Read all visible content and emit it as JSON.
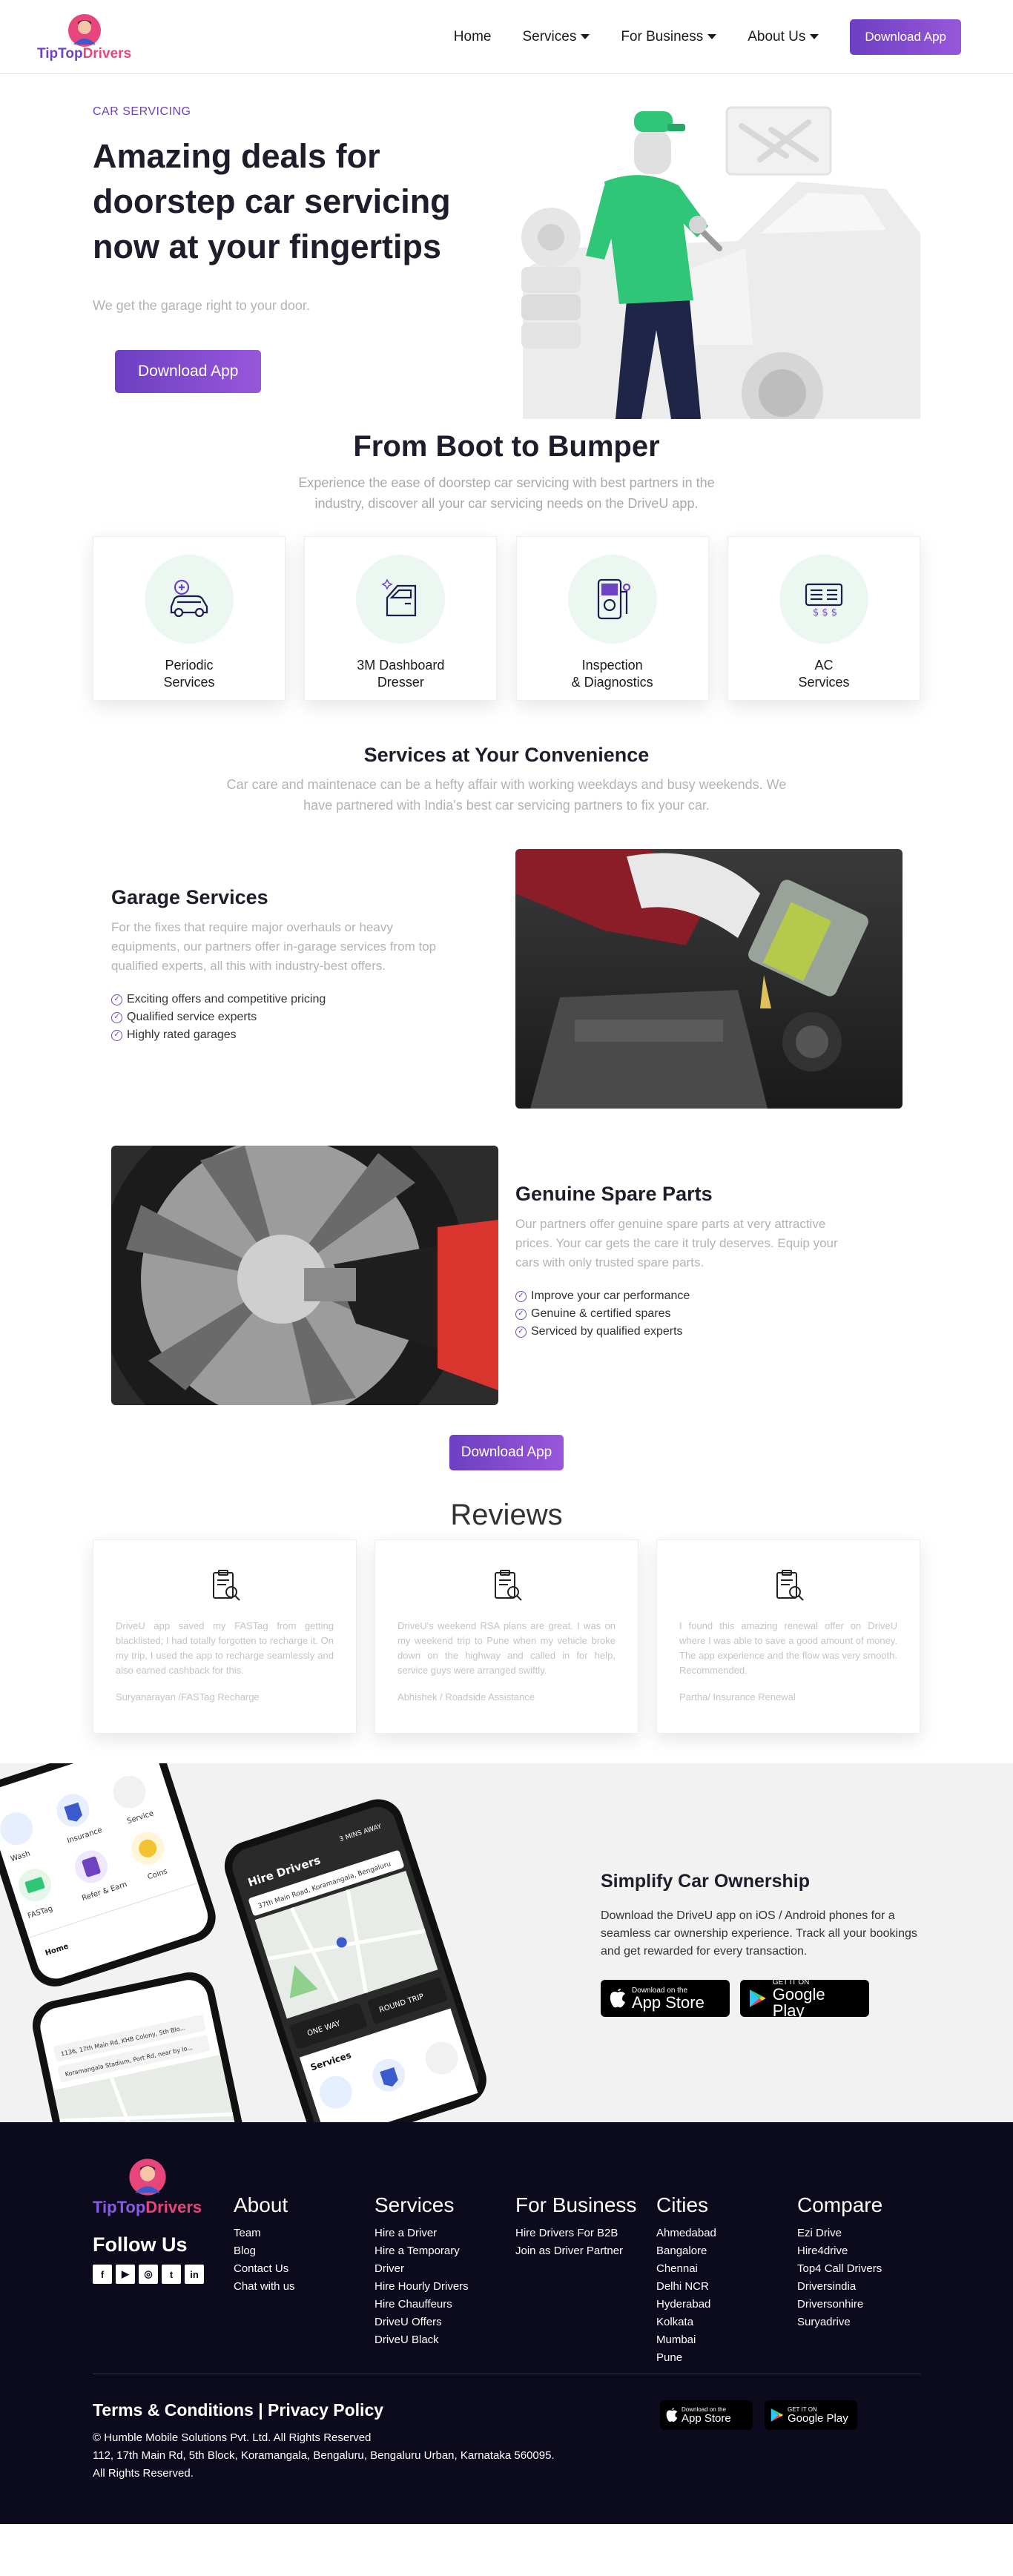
{
  "nav": {
    "brand_a": "TipTop",
    "brand_b": "Drivers",
    "items": [
      {
        "label": "Home"
      },
      {
        "label": "Services"
      },
      {
        "label": "For Business"
      },
      {
        "label": "About Us"
      }
    ],
    "cta": "Download App"
  },
  "hero": {
    "eyebrow": "CAR SERVICING",
    "title": "Amazing deals for doorstep car servicing now at your fingertips",
    "subtitle": "We get the garage right to your door.",
    "cta": "Download App"
  },
  "boot": {
    "title": "From Boot to Bumper",
    "desc": "Experience the ease of doorstep car servicing with best partners in the industry, discover all your car servicing needs on the DriveU app.",
    "services": [
      {
        "label": "Periodic\nServices",
        "icon": "car-wrench-icon"
      },
      {
        "label": "3M Dashboard\nDresser",
        "icon": "car-door-icon"
      },
      {
        "label": "Inspection\n& Diagnostics",
        "icon": "multimeter-icon"
      },
      {
        "label": "AC\nServices",
        "icon": "ac-unit-icon"
      }
    ]
  },
  "convenience": {
    "title": "Services at Your Convenience",
    "desc": "Car care and maintenace can be a hefty affair with working weekdays and busy weekends. We have partnered with India's best car servicing partners to fix your car."
  },
  "garage": {
    "title": "Garage Services",
    "desc": "For the fixes that require major overhauls or heavy equipments, our partners offer in-garage services from top qualified experts, all this with industry-best offers.",
    "points": [
      "Exciting offers and competitive pricing",
      "Qualified service experts",
      "Highly rated garages"
    ]
  },
  "spares": {
    "title": "Genuine Spare Parts",
    "desc": "Our partners offer genuine spare parts at very attractive prices. Your car gets the care it truly deserves. Equip your cars with only trusted spare parts.",
    "points": [
      "Improve your car performance",
      "Genuine & certified spares",
      "Serviced by qualified experts"
    ]
  },
  "mid_cta": "Download App",
  "reviews": {
    "title": "Reviews",
    "items": [
      {
        "text": "DriveU app saved my FASTag from getting blacklisted; I had totally forgotten to recharge it. On my trip, I used the app to recharge seamlessly and also earned cashback for this.",
        "author": "Suryanarayan /FASTag Recharge"
      },
      {
        "text": "DriveU's weekend RSA plans are great. I was on my weekend trip to Pune when my vehicle broke down on the highway and called in for help, service guys were arranged swiftly.",
        "author": "Abhishek / Roadside Assistance"
      },
      {
        "text": "I found this amazing renewal offer on DriveU where I was able to save a good amount of money. The app experience and the flow was very smooth. Recommended.",
        "author": "Partha/ Insurance Renewal"
      }
    ]
  },
  "app": {
    "title": "Simplify Car Ownership",
    "desc": "Download the DriveU app on iOS / Android phones for a seamless car ownership experience. Track all your bookings and get rewarded for every transaction.",
    "appstore_small": "Download on the",
    "appstore_big": "App Store",
    "play_small": "GET IT ON",
    "play_big": "Google Play",
    "phone": {
      "hire_title": "Hire Drivers",
      "eta": "3 MINS AWAY",
      "address": "37th Main Road, Koramangala, Bengaluru",
      "one_way": "ONE WAY",
      "round_trip": "ROUND TRIP",
      "services_label": "Services",
      "grid": [
        "Wash",
        "Insurance",
        "Service",
        "FASTag",
        "Refer & Earn",
        "Coins"
      ],
      "tab_home": "Home",
      "search_a": "1136, 17th Main Rd, KHB Colony, 5th Blo...",
      "search_b": "Koramangala Stadium, Port Rd, near by lo..."
    }
  },
  "footer": {
    "follow": "Follow Us",
    "socials": [
      "f",
      "▶",
      "◎",
      "t",
      "in"
    ],
    "columns": [
      {
        "title": "About",
        "links": [
          "Team",
          "Blog",
          "Contact Us",
          "Chat with us"
        ]
      },
      {
        "title": "Services",
        "links": [
          "Hire a Driver",
          "Hire a Temporary Driver",
          "Hire Hourly Drivers",
          "Hire Chauffeurs",
          "DriveU Offers",
          "DriveU Black"
        ]
      },
      {
        "title": "For Business",
        "links": [
          "Hire Drivers For B2B",
          "Join as Driver Partner"
        ]
      },
      {
        "title": "Cities",
        "links": [
          "Ahmedabad",
          "Bangalore",
          "Chennai",
          "Delhi NCR",
          "Hyderabad",
          "Kolkata",
          "Mumbai",
          "Pune"
        ]
      },
      {
        "title": "Compare",
        "links": [
          "Ezi Drive",
          "Hire4drive",
          "Top4 Call Drivers",
          "Driversindia",
          "Driversonhire",
          "Suryadrive"
        ]
      }
    ],
    "terms": "Terms & Conditions",
    "sep": "|",
    "privacy": "Privacy Policy",
    "copyright": "© Humble Mobile Solutions Pvt. Ltd. All Rights Reserved",
    "address": "112, 17th Main Rd, 5th Block, Koramangala, Bengaluru, Bengaluru Urban, Karnataka 560095.",
    "rights": "All Rights Reserved."
  },
  "colors": {
    "accent": "#6f42c1",
    "accent2": "#9857db",
    "brand_pink": "#e8457a",
    "mint": "#edf7f2",
    "footer_bg": "#0c0a1d",
    "app_bg": "#f2f2f2",
    "mechanic_green": "#2fc777"
  }
}
